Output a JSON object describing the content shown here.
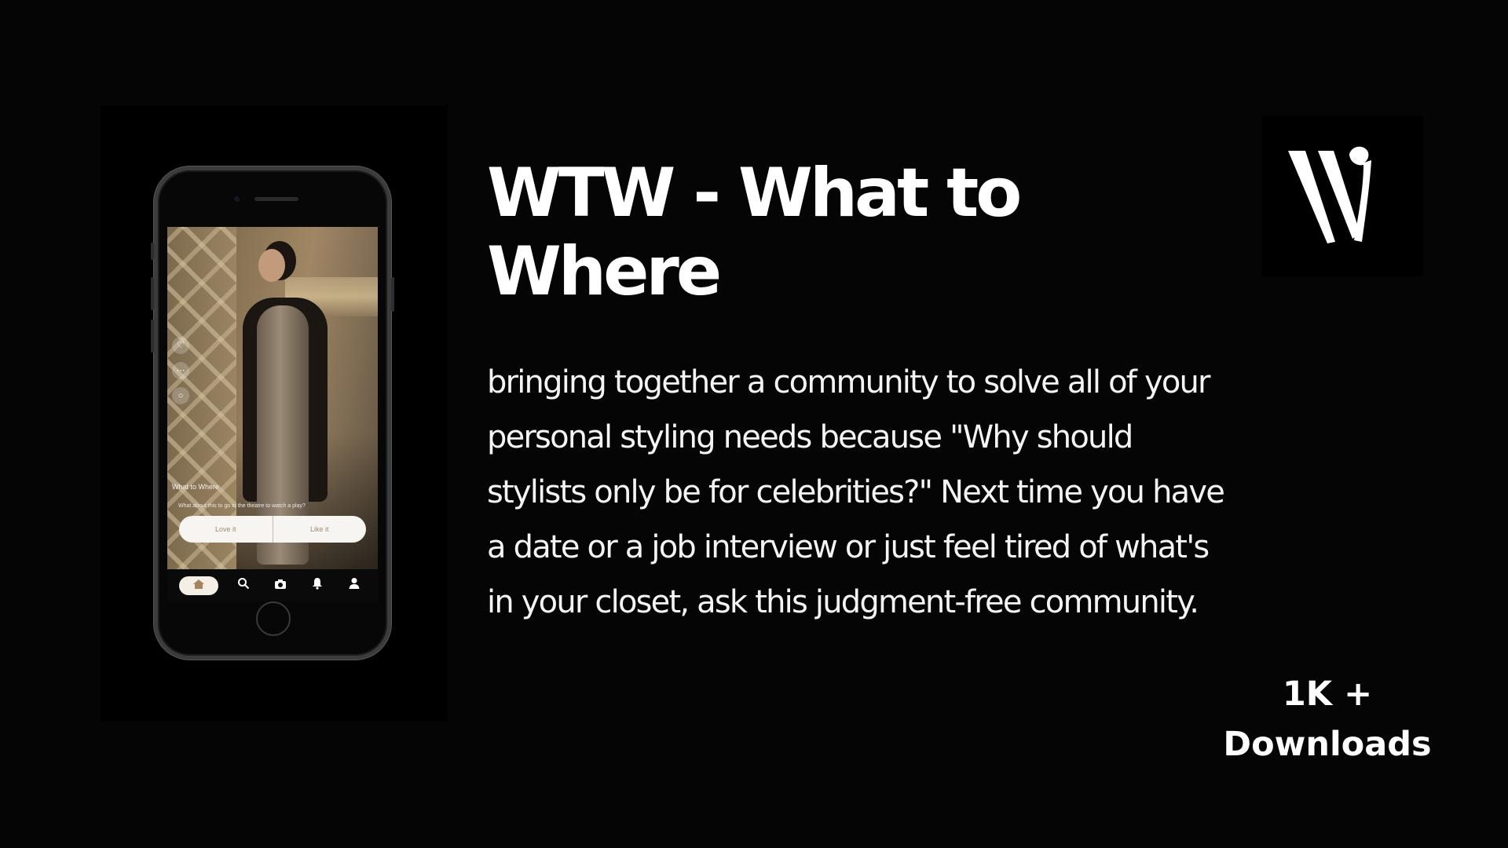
{
  "title": "WTW - What to Where",
  "description": "bringing together a community to solve all of your personal styling needs because \"Why should stylists only be for celebrities?\" Next time you have a date or a job interview or just feel tired of what's in your closet, ask this judgment-free community.",
  "stats": {
    "downloads_count": "1K +",
    "downloads_label": "Downloads"
  },
  "logo": {
    "icon": "w-monogram-logo"
  },
  "phone_screen": {
    "post_title": "What to Where",
    "post_question": "What about this to go to the theatre to watch a play?",
    "vote_options": [
      "Love it",
      "Like it"
    ],
    "side_actions": [
      "heart-icon",
      "more-icon",
      "comment-icon"
    ],
    "tabs": [
      "home-icon",
      "search-icon",
      "camera-icon",
      "bell-icon",
      "profile-icon"
    ]
  },
  "colors": {
    "background": "#050505",
    "text": "#ffffff",
    "vote_text": "#a08a72",
    "active_tab": "#f4eee6"
  }
}
